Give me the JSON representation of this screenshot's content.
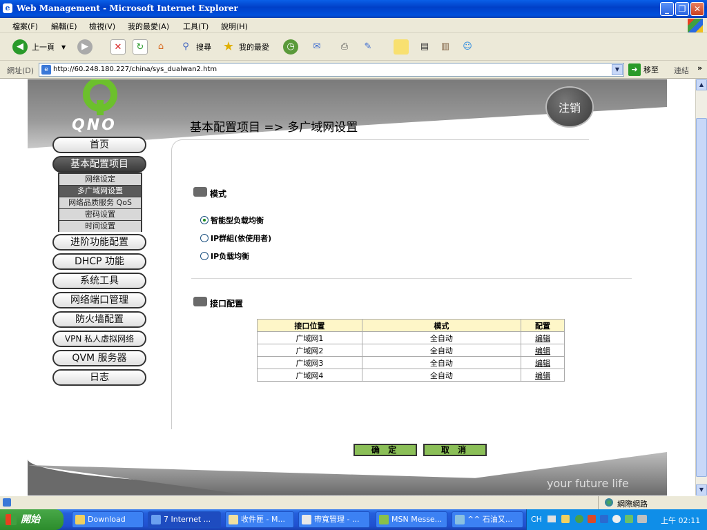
{
  "window": {
    "title": "Web Management - Microsoft Internet Explorer",
    "min_glyph": "_",
    "max_glyph": "❐",
    "close_glyph": "✕"
  },
  "menu": [
    "檔案(F)",
    "編輯(E)",
    "檢視(V)",
    "我的最愛(A)",
    "工具(T)",
    "說明(H)"
  ],
  "toolbar": {
    "back_label": "上一頁",
    "search_label": "搜尋",
    "favorites_label": "我的最愛"
  },
  "address": {
    "label": "網址(D)",
    "url": "http://60.248.180.227/china/sys_dualwan2.htm",
    "go_label": "移至",
    "links_label": "連結"
  },
  "page": {
    "logo_text": "QNO",
    "logout_label": "注销",
    "breadcrumb_title": "基本配置项目  => 多广域网设置",
    "slogan": "your future life"
  },
  "nav": [
    {
      "label": "首页"
    },
    {
      "label": "基本配置项目",
      "active": true
    },
    {
      "label": "进阶功能配置"
    },
    {
      "label": "DHCP 功能"
    },
    {
      "label": "系统工具"
    },
    {
      "label": "网络端口管理"
    },
    {
      "label": "防火墙配置"
    },
    {
      "label": "VPN 私人虚拟网络"
    },
    {
      "label": "QVM 服务器"
    },
    {
      "label": "日志"
    }
  ],
  "subnav": [
    "网络设定",
    "多广域网设置",
    "网络品质服务 QoS",
    "密码设置",
    "时间设置"
  ],
  "mode": {
    "heading": "模式",
    "options": [
      "智能型负载均衡",
      "IP群組(依使用者)",
      "IP负载均衡"
    ],
    "selected_index": 0
  },
  "interfaces": {
    "heading": "接口配置",
    "columns": [
      "接口位置",
      "模式",
      "配置"
    ],
    "rows": [
      {
        "port": "广域网1",
        "mode": "全自动",
        "action": "编辑"
      },
      {
        "port": "广域网2",
        "mode": "全自动",
        "action": "编辑"
      },
      {
        "port": "广域网3",
        "mode": "全自动",
        "action": "编辑"
      },
      {
        "port": "广域网4",
        "mode": "全自动",
        "action": "编辑"
      }
    ]
  },
  "buttons": {
    "ok": "确 定",
    "cancel": "取 消"
  },
  "statusbar": {
    "zone": "網際網路"
  },
  "taskbar": {
    "start_label": "開始",
    "tasks": [
      "Download",
      "7 Internet ...",
      "收件匣 - M...",
      "帶寬管理 - ...",
      "MSN Messe...",
      "^^ 石油又..."
    ],
    "lang": "CH",
    "clock": "上午 02:11"
  }
}
